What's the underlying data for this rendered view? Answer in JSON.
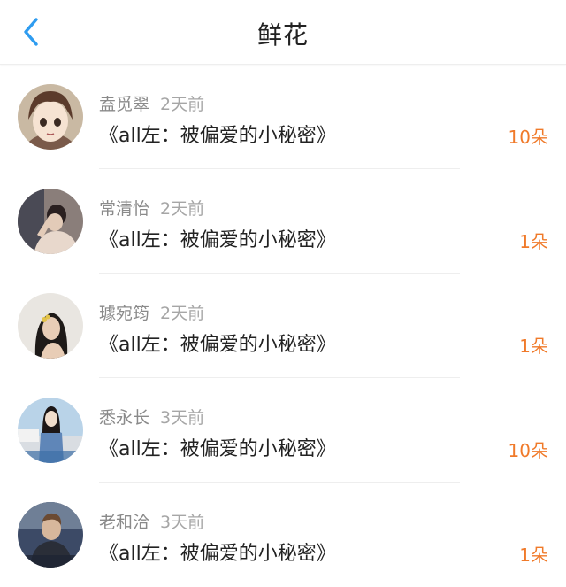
{
  "header": {
    "title": "鲜花",
    "back_icon": "chevron-left-icon",
    "accent_color": "#2e9cf0"
  },
  "list": {
    "count_color": "#f07a2a",
    "items": [
      {
        "name": "盍觅翠",
        "time": "2天前",
        "book": "《all左：被偏爱的小秘密》",
        "count": "10朵"
      },
      {
        "name": "常清怡",
        "time": "2天前",
        "book": "《all左：被偏爱的小秘密》",
        "count": "1朵"
      },
      {
        "name": "璩宛筠",
        "time": "2天前",
        "book": "《all左：被偏爱的小秘密》",
        "count": "1朵"
      },
      {
        "name": "悉永长",
        "time": "3天前",
        "book": "《all左：被偏爱的小秘密》",
        "count": "10朵"
      },
      {
        "name": "老和洽",
        "time": "3天前",
        "book": "《all左：被偏爱的小秘密》",
        "count": "1朵"
      }
    ]
  }
}
